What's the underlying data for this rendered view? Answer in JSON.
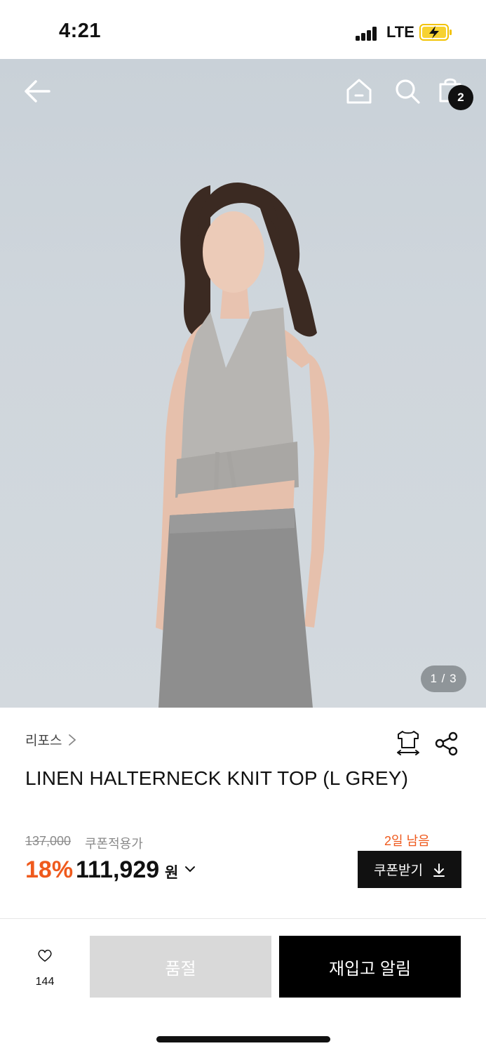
{
  "status_bar": {
    "time": "4:21",
    "network": "LTE",
    "icons": [
      "signal-icon",
      "battery-charging-icon"
    ]
  },
  "header": {
    "icons": [
      "back-arrow-icon",
      "home-icon",
      "search-icon",
      "shopping-bag-icon"
    ],
    "cart_count": "2"
  },
  "gallery": {
    "page_indicator": "1 / 3"
  },
  "product": {
    "brand": "리포스",
    "title": "LINEN HALTERNECK KNIT TOP (L GREY)",
    "original_price": "137,000",
    "coupon_label": "쿠폰적용가",
    "discount": "18%",
    "sale_price": "111,929",
    "currency": "원",
    "coupon_days_left": "2일 남음",
    "coupon_button": "쿠폰받기",
    "icons": [
      "size-guide-icon",
      "share-icon",
      "chevron-right-icon",
      "chevron-down-icon",
      "download-icon"
    ]
  },
  "bottom_bar": {
    "like_count": "144",
    "soldout_label": "품절",
    "restock_label": "재입고 알림",
    "icons": [
      "heart-icon"
    ]
  },
  "colors": {
    "accent": "#ef5a1d",
    "primary_button": "#000000",
    "disabled_button": "#d9d9d9"
  }
}
